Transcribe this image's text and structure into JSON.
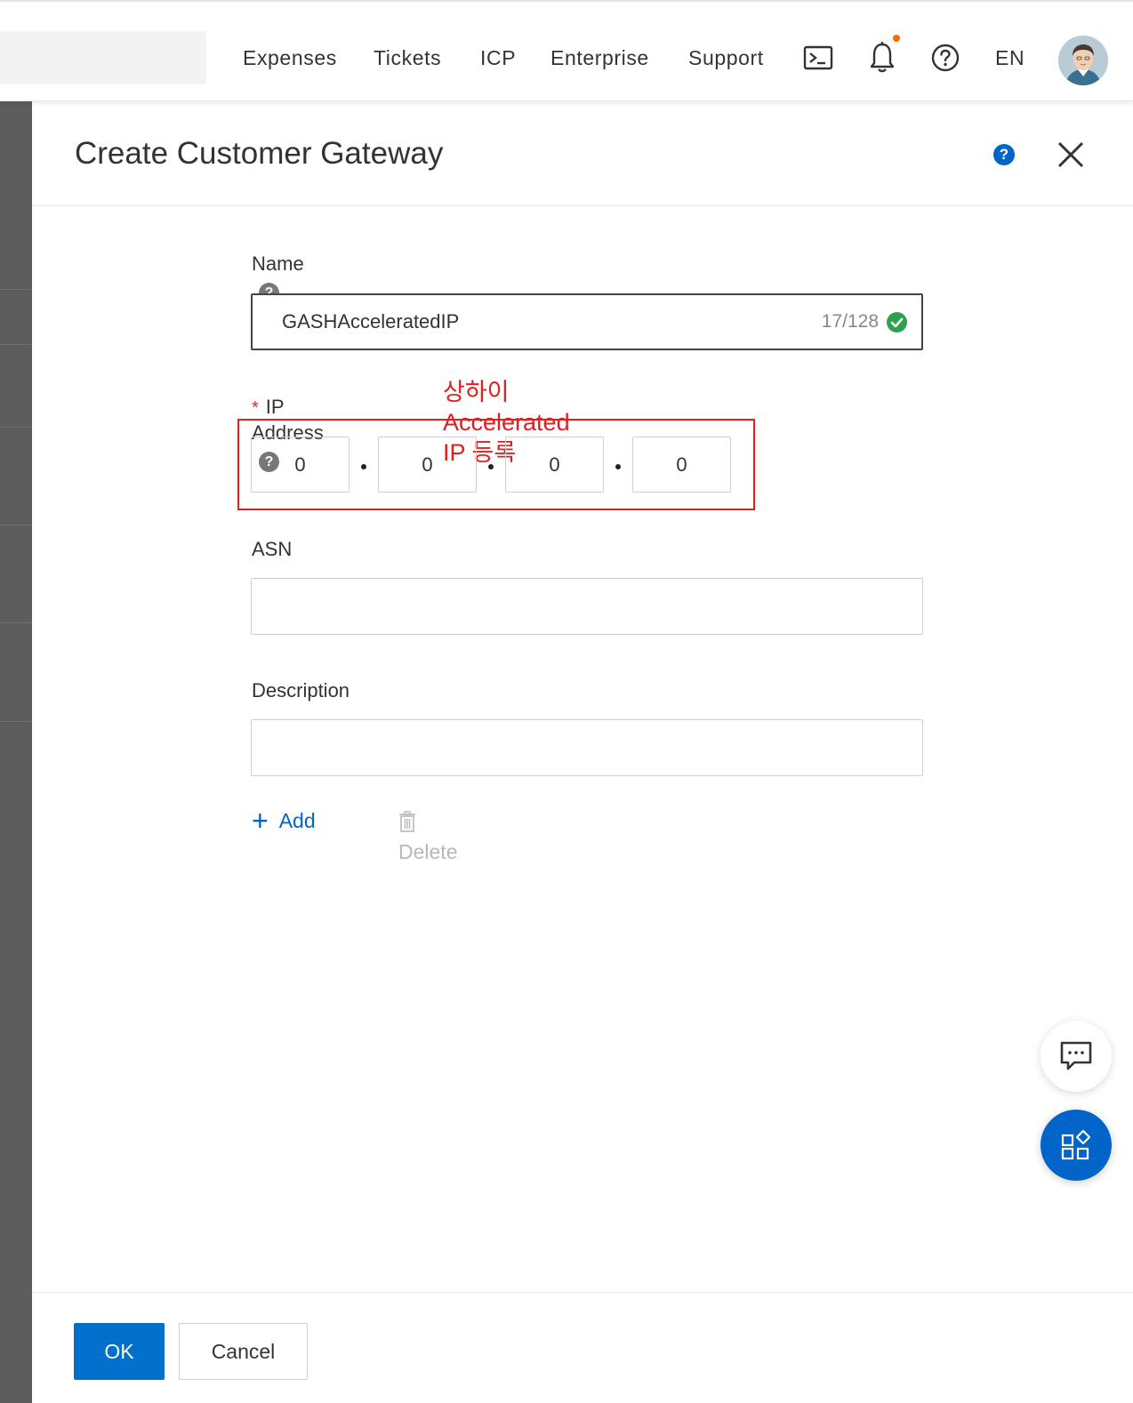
{
  "nav": {
    "links": [
      "Expenses",
      "Tickets",
      "ICP",
      "Enterprise",
      "Support"
    ],
    "language": "EN",
    "icons": [
      "terminal-icon",
      "bell-icon",
      "help-icon",
      "avatar"
    ]
  },
  "drawer": {
    "title": "Create Customer Gateway",
    "name_label": "Name",
    "name_value": "GASHAcceleratedIP",
    "name_counter": "17/128",
    "ip_label": "IP Address",
    "ip_required_mark": "*",
    "ip_octets": [
      "0",
      "0",
      "0",
      "0"
    ],
    "annotation": "상하이 Accelerated IP 등록",
    "asn_label": "ASN",
    "asn_value": "",
    "description_label": "Description",
    "description_value": "",
    "add_label": "Add",
    "delete_label": "Delete",
    "help_glyph": "?"
  },
  "footer": {
    "ok_label": "OK",
    "cancel_label": "Cancel"
  },
  "colors": {
    "primary": "#0070cc",
    "annotation_red": "#e02020",
    "success_green": "#2ba14c",
    "notification": "#ff6a00"
  }
}
